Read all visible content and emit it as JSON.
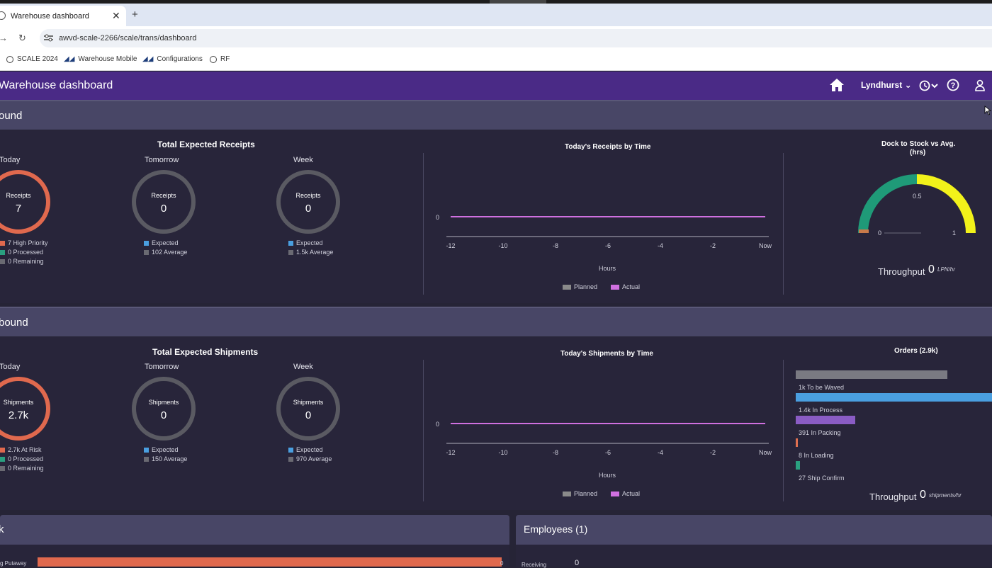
{
  "browser": {
    "tab_title": "Warehouse dashboard",
    "tab_close": "✕",
    "new_tab": "+",
    "url": "awvd-scale-2266/scale/trans/dashboard",
    "dropdown": "⌄",
    "bookmarks": [
      {
        "label": "SCALE 2024",
        "icon": "globe-icon"
      },
      {
        "label": "Warehouse Mobile",
        "icon": "logo-icon"
      },
      {
        "label": "Configurations",
        "icon": "logo-icon"
      },
      {
        "label": "RF",
        "icon": "globe-icon"
      }
    ]
  },
  "header": {
    "title": "Warehouse dashboard",
    "site": "Lyndhurst",
    "accent": "#4a2a86"
  },
  "inbound": {
    "section_title": "Inbound",
    "section_visible": "ound",
    "total_title": "Total Expected Receipts",
    "today": {
      "label": "Today",
      "center_label": "Receipts",
      "value": "7",
      "legend": [
        "7 High Priority",
        "0 Processed",
        "0 Remaining"
      ]
    },
    "tomorrow": {
      "label": "Tomorrow",
      "center_label": "Receipts",
      "value": "0",
      "legend": [
        "Expected",
        "102 Average"
      ]
    },
    "week": {
      "label": "Week",
      "center_label": "Receipts",
      "value": "0",
      "legend": [
        "Expected",
        "1.5k Average"
      ]
    },
    "chart_title": "Today's Receipts by Time",
    "chart_ytick": "0",
    "chart_xticks": [
      "-12",
      "-10",
      "-8",
      "-6",
      "-4",
      "-2",
      "Now"
    ],
    "chart_xlabel": "Hours",
    "chart_legend": [
      "Planned",
      "Actual"
    ],
    "gauge_title_1": "Dock to Stock vs Avg.",
    "gauge_title_2": "(hrs)",
    "gauge_ticks": [
      "0",
      "0.5",
      "1"
    ],
    "throughput_label": "Throughput",
    "throughput_value": "0",
    "throughput_unit": "LPN/hr"
  },
  "outbound": {
    "section_title": "Outbound",
    "section_visible": "bound",
    "total_title": "Total Expected Shipments",
    "today": {
      "label": "Today",
      "center_label": "Shipments",
      "value": "2.7k",
      "legend": [
        "2.7k At Risk",
        "0 Processed",
        "0 Remaining"
      ]
    },
    "tomorrow": {
      "label": "Tomorrow",
      "center_label": "Shipments",
      "value": "0",
      "legend": [
        "Expected",
        "150 Average"
      ]
    },
    "week": {
      "label": "Week",
      "center_label": "Shipments",
      "value": "0",
      "legend": [
        "Expected",
        "970 Average"
      ]
    },
    "chart_title": "Today's Shipments by Time",
    "chart_ytick": "0",
    "chart_xticks": [
      "-12",
      "-10",
      "-8",
      "-6",
      "-4",
      "-2",
      "Now"
    ],
    "chart_xlabel": "Hours",
    "chart_legend": [
      "Planned",
      "Actual"
    ],
    "orders_title": "Orders (2.9k)",
    "orders": [
      {
        "label": "1k To be Waved",
        "value": 1000,
        "color": "#7a7a82"
      },
      {
        "label": "1.4k In Process",
        "value": 1400,
        "color": "#4a9fe0"
      },
      {
        "label": "391 In Packing",
        "value": 391,
        "color": "#8a5cc4"
      },
      {
        "label": "8 In Loading",
        "value": 8,
        "color": "#e07050"
      },
      {
        "label": "27 Ship Confirm",
        "value": 27,
        "color": "#2aa080"
      }
    ],
    "throughput_label": "Throughput",
    "throughput_value": "0",
    "throughput_unit": "shipments/hr"
  },
  "work": {
    "section_visible": "k",
    "row_label": "g Putaway",
    "row_value": "0"
  },
  "employees": {
    "title": "Employees (1)",
    "row_label": "Receiving",
    "row_value": "0"
  },
  "chart_data": [
    {
      "type": "line",
      "title": "Today's Receipts by Time",
      "xlabel": "Hours",
      "x": [
        "-12",
        "-10",
        "-8",
        "-6",
        "-4",
        "-2",
        "Now"
      ],
      "series": [
        {
          "name": "Planned",
          "values": [
            0,
            0,
            0,
            0,
            0,
            0,
            0
          ]
        },
        {
          "name": "Actual",
          "values": [
            0,
            0,
            0,
            0,
            0,
            0,
            0
          ]
        }
      ],
      "legend": "bottom"
    },
    {
      "type": "line",
      "title": "Today's Shipments by Time",
      "xlabel": "Hours",
      "x": [
        "-12",
        "-10",
        "-8",
        "-6",
        "-4",
        "-2",
        "Now"
      ],
      "series": [
        {
          "name": "Planned",
          "values": [
            0,
            0,
            0,
            0,
            0,
            0,
            0
          ]
        },
        {
          "name": "Actual",
          "values": [
            0,
            0,
            0,
            0,
            0,
            0,
            0
          ]
        }
      ],
      "legend": "bottom"
    },
    {
      "type": "bar",
      "title": "Orders (2.9k)",
      "categories": [
        "To be Waved",
        "In Process",
        "In Packing",
        "In Loading",
        "Ship Confirm"
      ],
      "values": [
        1000,
        1400,
        391,
        8,
        27
      ]
    }
  ]
}
